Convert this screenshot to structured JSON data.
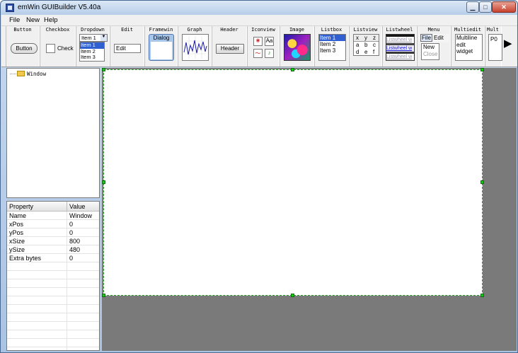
{
  "window": {
    "title": "emWin GUIBuilder V5.40a"
  },
  "title_buttons": {
    "minimize": "▁",
    "maximize": "□",
    "close": "✕"
  },
  "menu": [
    "File",
    "New",
    "Help"
  ],
  "toolbar": {
    "labels": [
      "Button",
      "Checkbox",
      "Dropdown",
      "Edit",
      "Framewin",
      "Graph",
      "Header",
      "Iconview",
      "Image",
      "Listbox",
      "Listview",
      "Listwheel",
      "Menu",
      "Multiedit",
      "Mult"
    ],
    "button_demo": "Button",
    "checkbox_demo": "Check",
    "dropdown_demo": {
      "selected": "Item 1",
      "items": [
        "Item 1",
        "Item 2",
        "Item 3"
      ]
    },
    "edit_demo": "Edit",
    "framewin_demo": "Dialog",
    "header_demo": "Header",
    "iconview_demo": "Aa",
    "listbox_demo": [
      "Item 1",
      "Item 2",
      "Item 3"
    ],
    "listview_demo": [
      [
        "x",
        "y",
        "z"
      ],
      [
        "a",
        "b",
        "c"
      ],
      [
        "d",
        "e",
        "f"
      ]
    ],
    "listwheel_demo": [
      "Listwheel w",
      "Listwheel w",
      "Listwheel w"
    ],
    "menu_demo": {
      "top": [
        "File",
        "Edit"
      ],
      "items": [
        "New",
        "Close"
      ]
    },
    "multiedit_demo": [
      "Multiline",
      "edit",
      "widget"
    ],
    "mult_demo": "P0",
    "scroll_arrow": "▶"
  },
  "tree": {
    "root": "Window"
  },
  "properties": {
    "headers": [
      "Property",
      "Value"
    ],
    "rows": [
      {
        "name": "Name",
        "value": "Window"
      },
      {
        "name": "xPos",
        "value": "0"
      },
      {
        "name": "yPos",
        "value": "0"
      },
      {
        "name": "xSize",
        "value": "800"
      },
      {
        "name": "ySize",
        "value": "480"
      },
      {
        "name": "Extra bytes",
        "value": "0"
      }
    ]
  },
  "colors": {
    "canvas_border": "#2da02d",
    "workarea": "#7a7a7a",
    "handle": "#17c917"
  }
}
